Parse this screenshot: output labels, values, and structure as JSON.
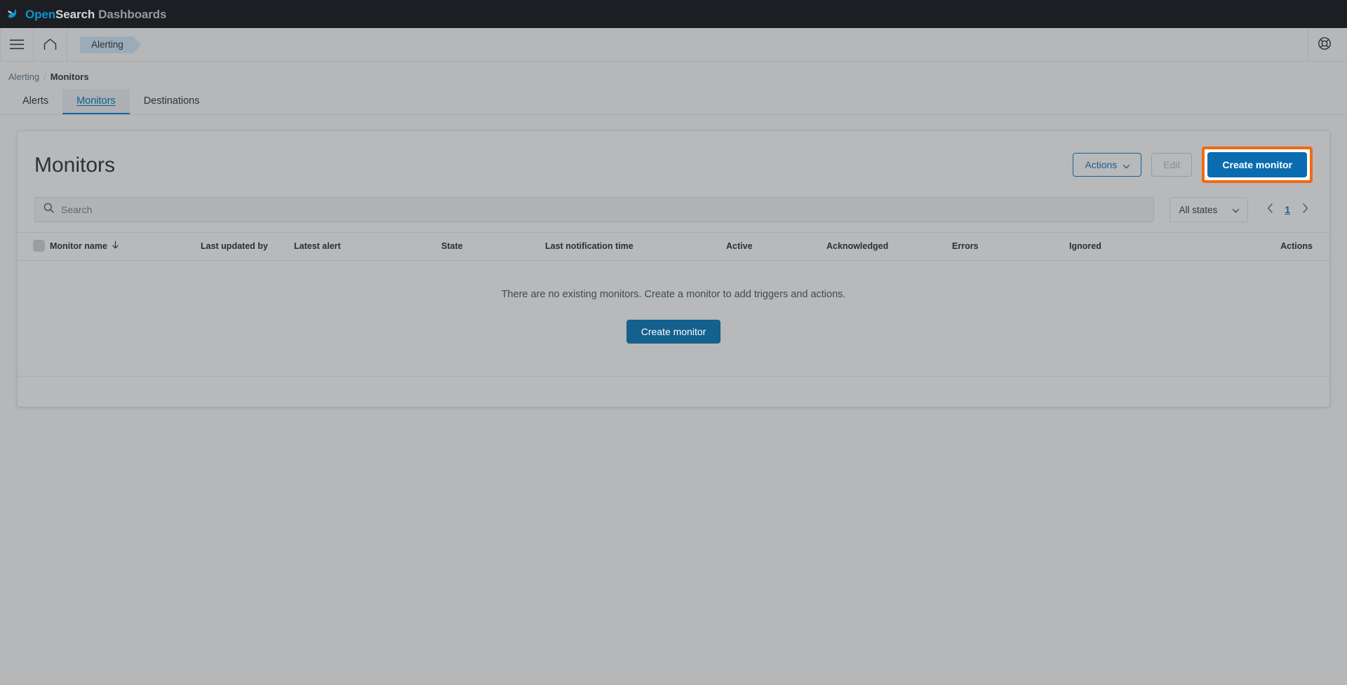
{
  "app": {
    "logo": {
      "icon": "opensearch-logo-icon",
      "part_open": "Open",
      "part_search": "Search",
      "part_dashboards": "Dashboards"
    }
  },
  "nav": {
    "menu_icon": "hamburger-menu-icon",
    "home_icon": "home-icon",
    "breadcrumb_chip": "Alerting",
    "help_icon": "help-lifebuoy-icon"
  },
  "breadcrumbs": [
    {
      "label": "Alerting",
      "current": false
    },
    {
      "label": "Monitors",
      "current": true
    }
  ],
  "breadcrumb_separator": "/",
  "tabs": [
    {
      "label": "Alerts",
      "selected": false
    },
    {
      "label": "Monitors",
      "selected": true
    },
    {
      "label": "Destinations",
      "selected": false
    }
  ],
  "panel": {
    "title": "Monitors",
    "actions_button": "Actions",
    "actions_caret_icon": "chevron-down-icon",
    "edit_button": "Edit",
    "create_button": "Create monitor"
  },
  "search": {
    "icon": "search-icon",
    "placeholder": "Search",
    "value": ""
  },
  "filter": {
    "state_label": "All states",
    "caret_icon": "chevron-down-icon"
  },
  "pagination": {
    "prev_icon": "chevron-left-icon",
    "next_icon": "chevron-right-icon",
    "current_page": "1"
  },
  "table": {
    "select_all_checkbox": "select-all-checkbox",
    "sort_icon": "arrow-down-icon",
    "columns": [
      "Monitor name",
      "Last updated by",
      "Latest alert",
      "State",
      "Last notification time",
      "Active",
      "Acknowledged",
      "Errors",
      "Ignored",
      "Actions"
    ],
    "empty_message": "There are no existing monitors. Create a monitor to add triggers and actions.",
    "empty_button": "Create monitor"
  },
  "colors": {
    "brand_blue": "#0a96cd",
    "primary_button": "#0a6cb0",
    "highlight_ring": "#f26a10",
    "link_blue": "#14618f",
    "header_dark": "#1d1e24"
  }
}
